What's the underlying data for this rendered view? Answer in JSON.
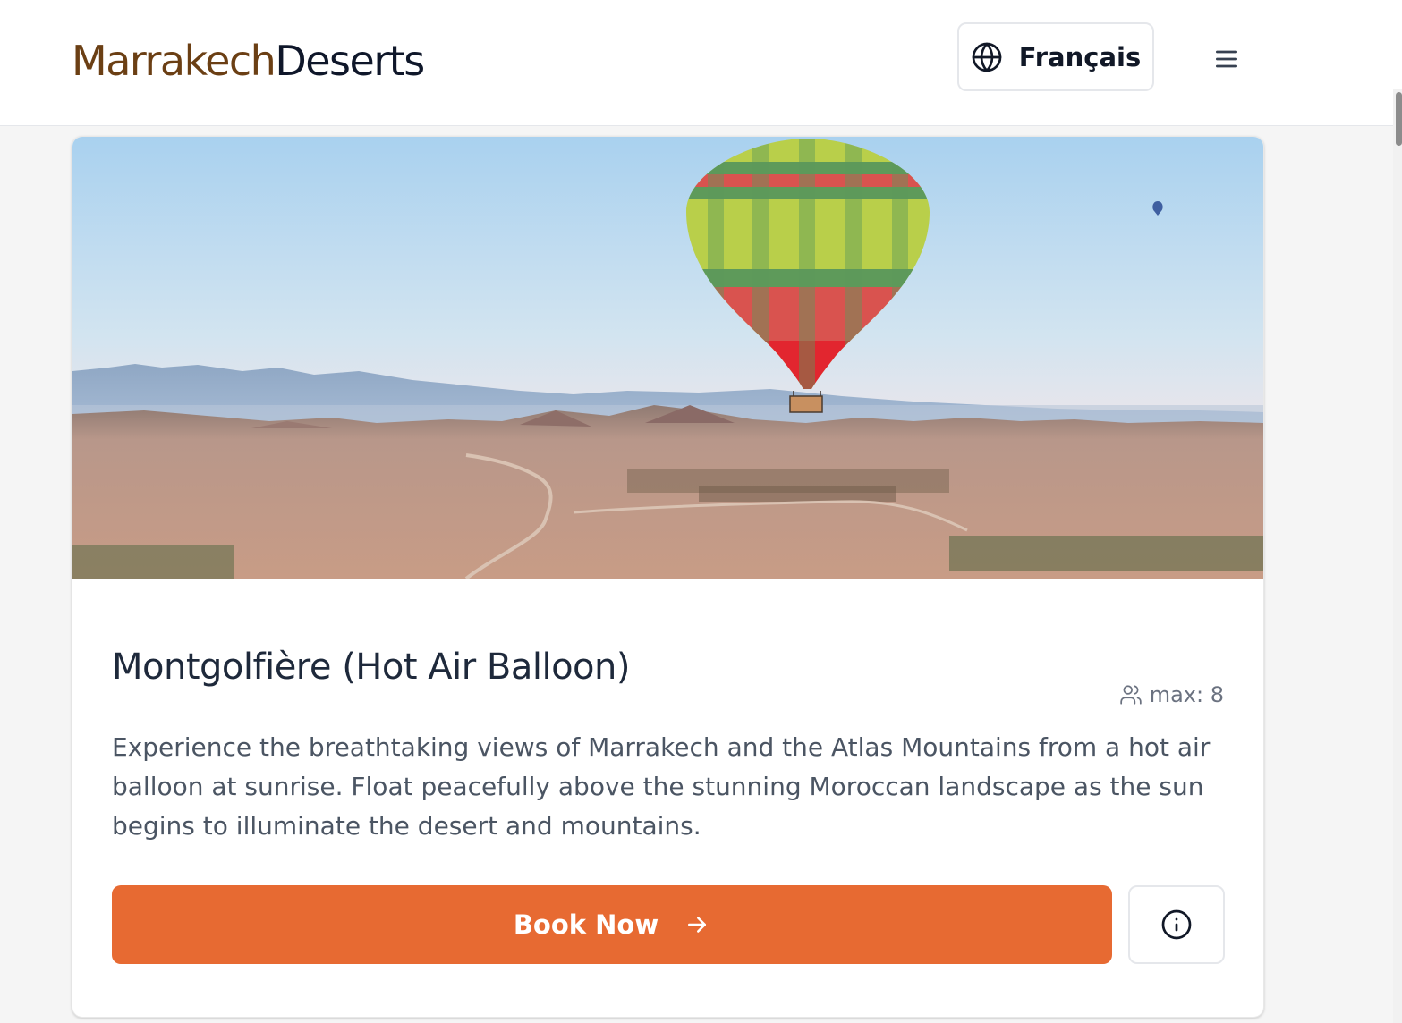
{
  "header": {
    "logo_part1": "Marrakech",
    "logo_part2": "Deserts",
    "language_label": "Français",
    "language_icon": "globe-icon",
    "menu_icon": "hamburger-menu-icon"
  },
  "card": {
    "image_alt": "Hot air balloon over the desert near Marrakech at sunrise",
    "title": "Montgolfière (Hot Air Balloon)",
    "capacity_icon": "users-icon",
    "capacity_text": "max: 8",
    "description": "Experience the breathtaking views of Marrakech and the Atlas Mountains from a hot air balloon at sunrise. Float peacefully above the stunning Moroccan landscape as the sun begins to illuminate the desert and mountains.",
    "book_label": "Book Now",
    "book_icon": "arrow-right-icon",
    "info_icon": "info-icon"
  },
  "colors": {
    "brand_brown": "#6b3f14",
    "brand_dark": "#0f172a",
    "accent_orange": "#e76a32"
  }
}
